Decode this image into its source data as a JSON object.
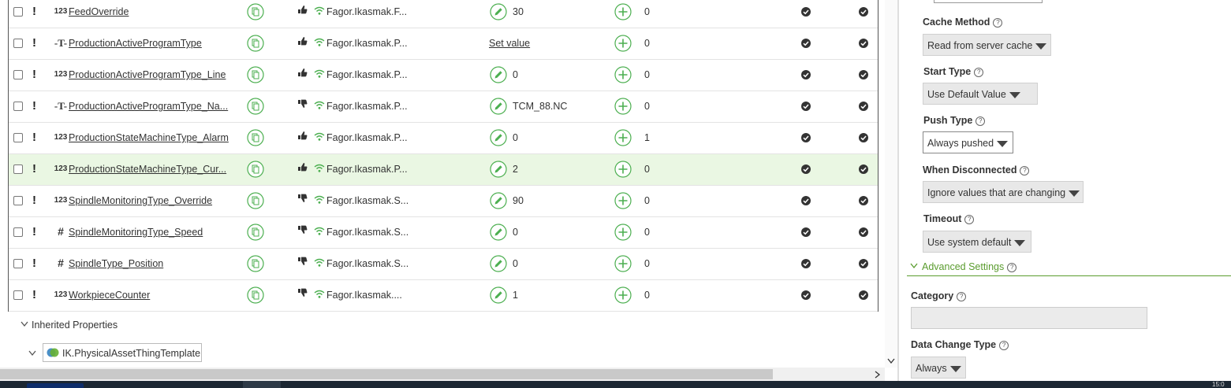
{
  "colors": {
    "accent_green": "#5a9c2e",
    "icon_green": "#4caf50",
    "selected_row": "#eaf7e3",
    "check_dark": "#333333"
  },
  "properties": [
    {
      "type": "123",
      "name": "FeedOverride",
      "quality": "thumb-up",
      "source": "Fagor.Ikasmak.F...",
      "value": "30",
      "value_is_link": false,
      "count": "0",
      "selected": false
    },
    {
      "type": "T",
      "name": "ProductionActiveProgramType",
      "quality": "thumb-up",
      "source": "Fagor.Ikasmak.P...",
      "value": "Set value",
      "value_is_link": true,
      "count": "0",
      "selected": false
    },
    {
      "type": "123",
      "name": "ProductionActiveProgramType_Line",
      "quality": "thumb-up",
      "source": "Fagor.Ikasmak.P...",
      "value": "0",
      "value_is_link": false,
      "count": "0",
      "selected": false
    },
    {
      "type": "T",
      "name": "ProductionActiveProgramType_Na...",
      "quality": "thumb-down",
      "source": "Fagor.Ikasmak.P...",
      "value": "TCM_88.NC",
      "value_is_link": false,
      "count": "0",
      "selected": false
    },
    {
      "type": "123",
      "name": "ProductionStateMachineType_Alarm",
      "quality": "thumb-up",
      "source": "Fagor.Ikasmak.P...",
      "value": "0",
      "value_is_link": false,
      "count": "1",
      "selected": false
    },
    {
      "type": "123",
      "name": "ProductionStateMachineType_Cur...",
      "quality": "thumb-up",
      "source": "Fagor.Ikasmak.P...",
      "value": "2",
      "value_is_link": false,
      "count": "0",
      "selected": true
    },
    {
      "type": "123",
      "name": "SpindleMonitoringType_Override",
      "quality": "thumb-down",
      "source": "Fagor.Ikasmak.S...",
      "value": "90",
      "value_is_link": false,
      "count": "0",
      "selected": false
    },
    {
      "type": "#",
      "name": "SpindleMonitoringType_Speed",
      "quality": "thumb-down",
      "source": "Fagor.Ikasmak.S...",
      "value": "0",
      "value_is_link": false,
      "count": "0",
      "selected": false
    },
    {
      "type": "#",
      "name": "SpindleType_Position",
      "quality": "thumb-down",
      "source": "Fagor.Ikasmak.S...",
      "value": "0",
      "value_is_link": false,
      "count": "0",
      "selected": false
    },
    {
      "type": "123",
      "name": "WorkpieceCounter",
      "quality": "thumb-down",
      "source": "Fagor.Ikasmak....",
      "value": "1",
      "value_is_link": false,
      "count": "0",
      "selected": false
    }
  ],
  "inherited": {
    "label": "Inherited Properties",
    "template": "IK.PhysicalAssetThingTemplate"
  },
  "panel": {
    "cache_method": {
      "label": "Cache Method",
      "value": "Read from server cache"
    },
    "start_type": {
      "label": "Start Type",
      "value": "Use Default Value"
    },
    "push_type": {
      "label": "Push Type",
      "value": "Always pushed"
    },
    "when_disconnected": {
      "label": "When Disconnected",
      "value": "Ignore values that are changing"
    },
    "timeout": {
      "label": "Timeout",
      "value": "Use system default"
    },
    "advanced": {
      "label": "Advanced Settings"
    },
    "category": {
      "label": "Category",
      "value": ""
    },
    "data_change_type": {
      "label": "Data Change Type",
      "value": "Always"
    }
  },
  "help_glyph": "?",
  "clock": "15:0"
}
